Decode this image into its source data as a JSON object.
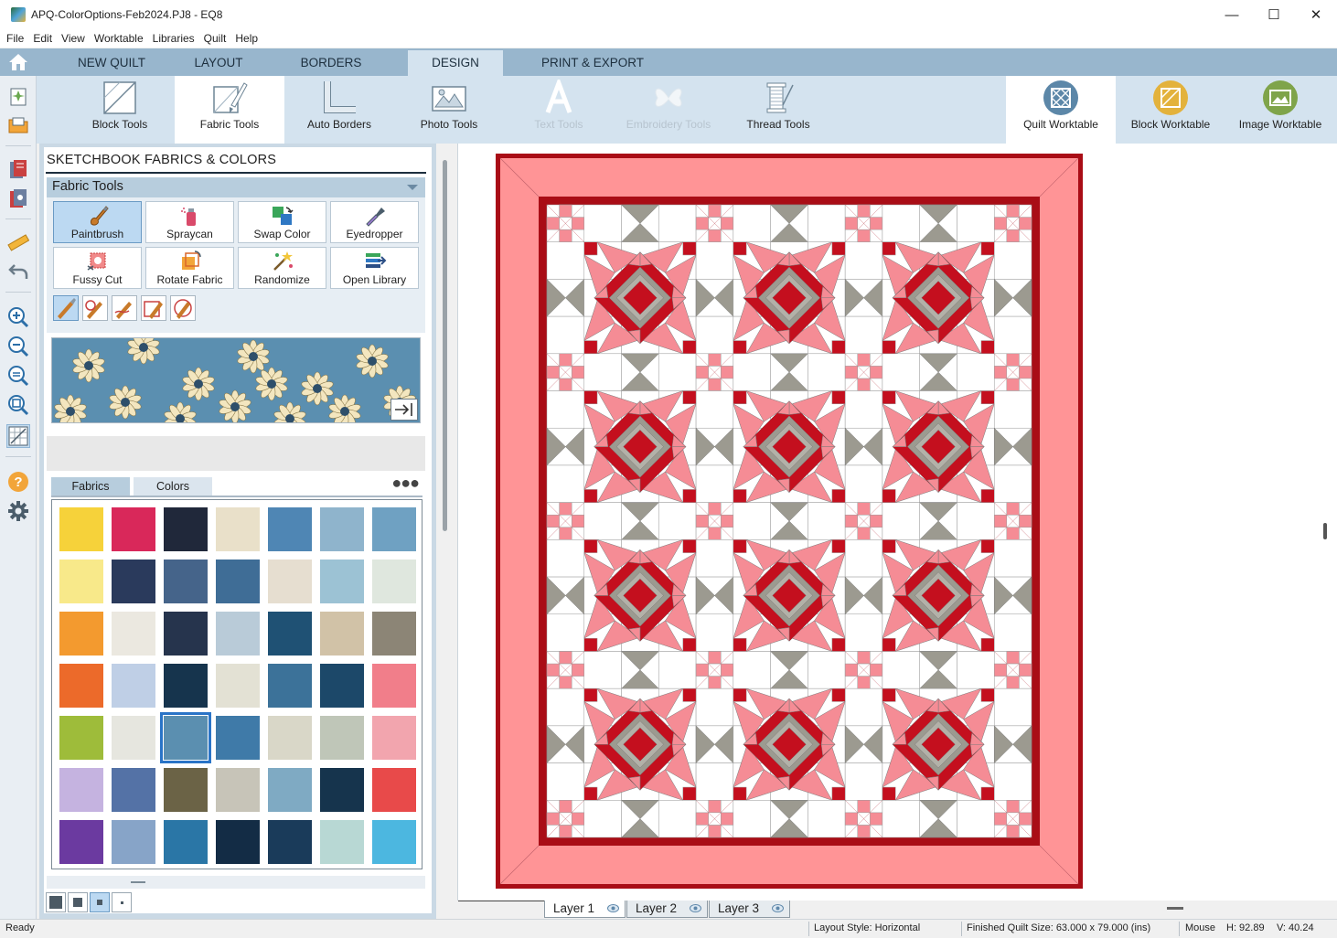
{
  "window": {
    "title": "APQ-ColorOptions-Feb2024.PJ8 - EQ8",
    "minimize_glyph": "—",
    "maximize_glyph": "☐",
    "close_glyph": "✕"
  },
  "menu": [
    "File",
    "Edit",
    "View",
    "Worktable",
    "Libraries",
    "Quilt",
    "Help"
  ],
  "tabs": [
    {
      "label": "NEW QUILT",
      "active": false
    },
    {
      "label": "LAYOUT",
      "active": false
    },
    {
      "label": "BORDERS",
      "active": false
    },
    {
      "label": "DESIGN",
      "active": true
    },
    {
      "label": "PRINT & EXPORT",
      "active": false
    }
  ],
  "ribbon": {
    "tools": [
      {
        "label": "Block Tools",
        "icon": "block-tools-icon"
      },
      {
        "label": "Fabric Tools",
        "icon": "fabric-tools-icon",
        "selected": true
      },
      {
        "label": "Auto Borders",
        "icon": "auto-borders-icon"
      },
      {
        "label": "Photo Tools",
        "icon": "photo-tools-icon"
      },
      {
        "label": "Text Tools",
        "icon": "text-tools-icon",
        "disabled": true
      },
      {
        "label": "Embroidery Tools",
        "icon": "embroidery-tools-icon",
        "disabled": true
      },
      {
        "label": "Thread Tools",
        "icon": "thread-tools-icon"
      }
    ],
    "worktables": [
      {
        "label": "Quilt Worktable",
        "icon": "quilt-worktable-icon",
        "color": "#5c87a8",
        "selected": true
      },
      {
        "label": "Block Worktable",
        "icon": "block-worktable-icon",
        "color": "#e3b23c"
      },
      {
        "label": "Image Worktable",
        "icon": "image-worktable-icon",
        "color": "#7fa44a"
      }
    ]
  },
  "palette": {
    "title": "SKETCHBOOK FABRICS & COLORS",
    "section_title": "Fabric Tools",
    "tools": [
      {
        "label": "Paintbrush",
        "icon": "paintbrush-icon",
        "selected": true
      },
      {
        "label": "Spraycan",
        "icon": "spraycan-icon"
      },
      {
        "label": "Swap Color",
        "icon": "swap-color-icon"
      },
      {
        "label": "Eyedropper",
        "icon": "eyedropper-icon"
      },
      {
        "label": "Fussy Cut",
        "icon": "fussy-cut-icon"
      },
      {
        "label": "Rotate Fabric",
        "icon": "rotate-fabric-icon"
      },
      {
        "label": "Randomize",
        "icon": "randomize-icon"
      },
      {
        "label": "Open Library",
        "icon": "open-library-icon"
      }
    ],
    "brush_modes": [
      "brush-mode-1",
      "brush-mode-2",
      "brush-mode-3",
      "brush-mode-4",
      "brush-mode-5"
    ],
    "tabs": [
      {
        "label": "Fabrics",
        "active": true
      },
      {
        "label": "Colors",
        "active": false
      }
    ],
    "more_glyph": "●●●",
    "selected_swatch": 30,
    "swatches": [
      "#f6d23a",
      "#d9285a",
      "#20283a",
      "#e9e0c9",
      "#4f86b4",
      "#8fb4cc",
      "#6fa1c2",
      "#f8e98a",
      "#2a3a5c",
      "#45648a",
      "#3f6d96",
      "#e6ded0",
      "#9cc2d4",
      "#dfe7de",
      "#f39a2f",
      "#ebe8e0",
      "#26344d",
      "#b9cbd8",
      "#1f5174",
      "#d1c2a7",
      "#8c8576",
      "#ec6a2a",
      "#bfcfe6",
      "#16344d",
      "#e3e1d4",
      "#3c7299",
      "#1c4869",
      "#f17e8a",
      "#9ebc3a",
      "#e6e6df",
      "#5b8fb0",
      "#3f7aa8",
      "#d9d7c8",
      "#bfc6b8",
      "#f2a5ae",
      "#c5b3e0",
      "#5472a6",
      "#6b6346",
      "#c7c4b8",
      "#7faac3",
      "#16344d",
      "#e84a4a",
      "#6b3aa0",
      "#87a4c8",
      "#2a76a6",
      "#132c45",
      "#1a3b5a",
      "#b8d8d4",
      "#4cb7e0"
    ],
    "size_modes": [
      "large",
      "medium",
      "small",
      "tiny"
    ]
  },
  "quilt": {
    "border_color": "#ff9496",
    "binding_color": "#a90d16",
    "background": "#ffffff",
    "red": "#c40f1e",
    "pink": "#f58c95",
    "gray": "#9c9a90"
  },
  "layers": [
    {
      "label": "Layer 1",
      "active": true
    },
    {
      "label": "Layer 2",
      "active": false
    },
    {
      "label": "Layer 3",
      "active": false
    }
  ],
  "status": {
    "ready": "Ready",
    "layout_style": "Layout Style: Horizontal",
    "finished_size": "Finished Quilt Size: 63.000 x 79.000 (ins)",
    "mouse_label": "Mouse",
    "mouse_h": "H:  92.89",
    "mouse_v": "V:  40.24"
  }
}
